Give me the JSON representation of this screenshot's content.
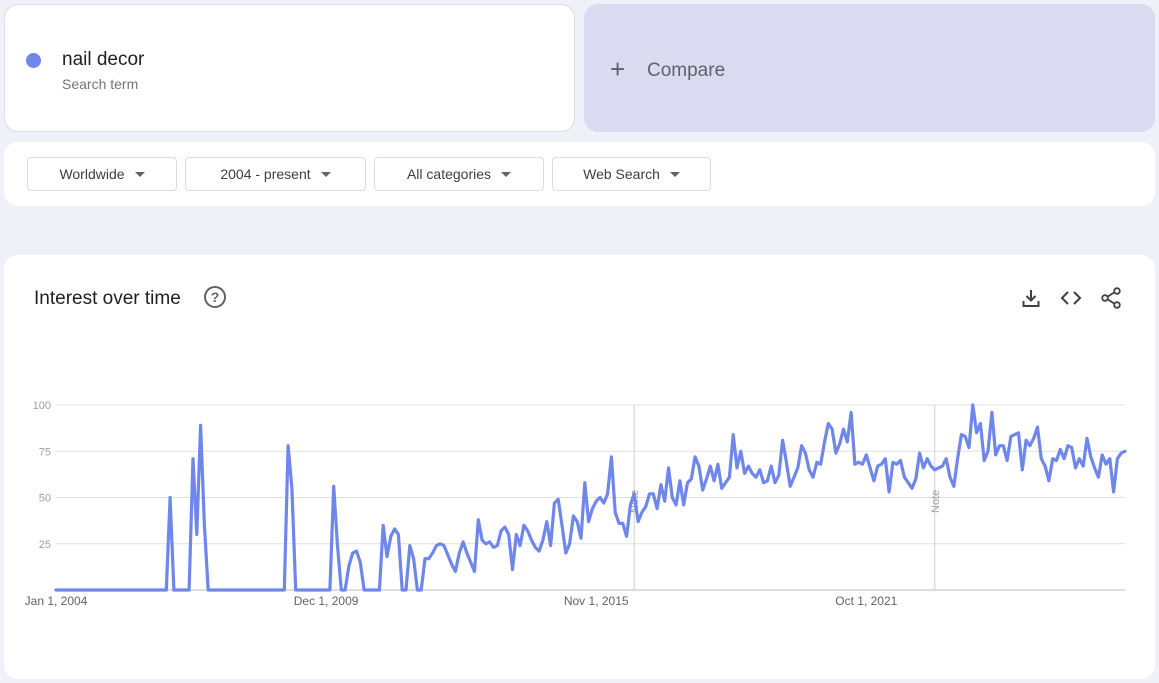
{
  "search_term": {
    "name": "nail decor",
    "subtitle": "Search term",
    "color": "#6f86ea"
  },
  "compare": {
    "plus": "+",
    "label": "Compare"
  },
  "filters": [
    {
      "label": "Worldwide"
    },
    {
      "label": "2004 - present"
    },
    {
      "label": "All categories"
    },
    {
      "label": "Web Search"
    }
  ],
  "chart": {
    "title": "Interest over time",
    "help_icon": "question-circle-icon",
    "tools": [
      "download-icon",
      "embed-code-icon",
      "share-icon"
    ]
  },
  "chart_data": {
    "type": "line",
    "title": "Interest over time",
    "ylim": [
      0,
      100
    ],
    "y_ticks": [
      "100",
      "75",
      "50",
      "25"
    ],
    "x_tick_labels": [
      "Jan 1, 2004",
      "Dec 1, 2009",
      "Nov 1, 2015",
      "Oct 1, 2021"
    ],
    "notes": [
      "Note",
      "Note"
    ],
    "grid": true,
    "line_color": "#6f86ea",
    "series": [
      {
        "values": [
          0,
          0,
          0,
          0,
          0,
          0,
          0,
          0,
          0,
          0,
          0,
          0,
          0,
          0,
          0,
          0,
          0,
          0,
          0,
          0,
          0,
          0,
          0,
          0,
          0,
          0,
          0,
          0,
          0,
          0,
          50,
          0,
          0,
          0,
          0,
          0,
          71,
          30,
          89,
          35,
          0,
          0,
          0,
          0,
          0,
          0,
          0,
          0,
          0,
          0,
          0,
          0,
          0,
          0,
          0,
          0,
          0,
          0,
          0,
          0,
          0,
          78,
          55,
          0,
          0,
          0,
          0,
          0,
          0,
          0,
          0,
          0,
          0,
          56,
          24,
          0,
          0,
          13,
          20,
          21,
          15,
          0,
          0,
          0,
          0,
          0,
          35,
          18,
          29,
          33,
          30,
          0,
          0,
          24,
          17,
          0,
          0,
          17,
          17,
          20,
          24,
          25,
          24,
          19,
          14,
          10,
          20,
          26,
          20,
          15,
          10,
          38,
          27,
          25,
          26,
          23,
          24,
          32,
          34,
          30,
          11,
          30,
          24,
          35,
          32,
          27,
          23,
          21,
          27,
          37,
          24,
          47,
          49,
          35,
          20,
          25,
          40,
          37,
          28,
          58,
          37,
          44,
          48,
          50,
          47,
          52,
          72,
          42,
          36,
          36,
          29,
          46,
          52,
          37,
          42,
          45,
          52,
          52,
          44,
          57,
          48,
          66,
          50,
          46,
          59,
          46,
          58,
          60,
          72,
          67,
          54,
          60,
          67,
          59,
          68,
          55,
          58,
          61,
          84,
          66,
          75,
          63,
          67,
          63,
          61,
          65,
          58,
          59,
          67,
          58,
          62,
          81,
          69,
          56,
          61,
          66,
          78,
          74,
          65,
          61,
          69,
          68,
          80,
          90,
          87,
          74,
          79,
          87,
          80,
          96,
          68,
          69,
          68,
          73,
          66,
          59,
          67,
          68,
          71,
          53,
          69,
          68,
          70,
          61,
          58,
          55,
          60,
          74,
          66,
          71,
          67,
          65,
          66,
          67,
          71,
          61,
          56,
          71,
          84,
          83,
          77,
          100,
          85,
          90,
          70,
          75,
          96,
          73,
          78,
          78,
          70,
          83,
          84,
          85,
          65,
          81,
          78,
          82,
          88,
          71,
          67,
          59,
          71,
          70,
          76,
          71,
          78,
          77,
          66,
          71,
          67,
          82,
          72,
          66,
          61,
          73,
          68,
          71,
          53,
          71,
          74,
          75
        ]
      }
    ]
  }
}
